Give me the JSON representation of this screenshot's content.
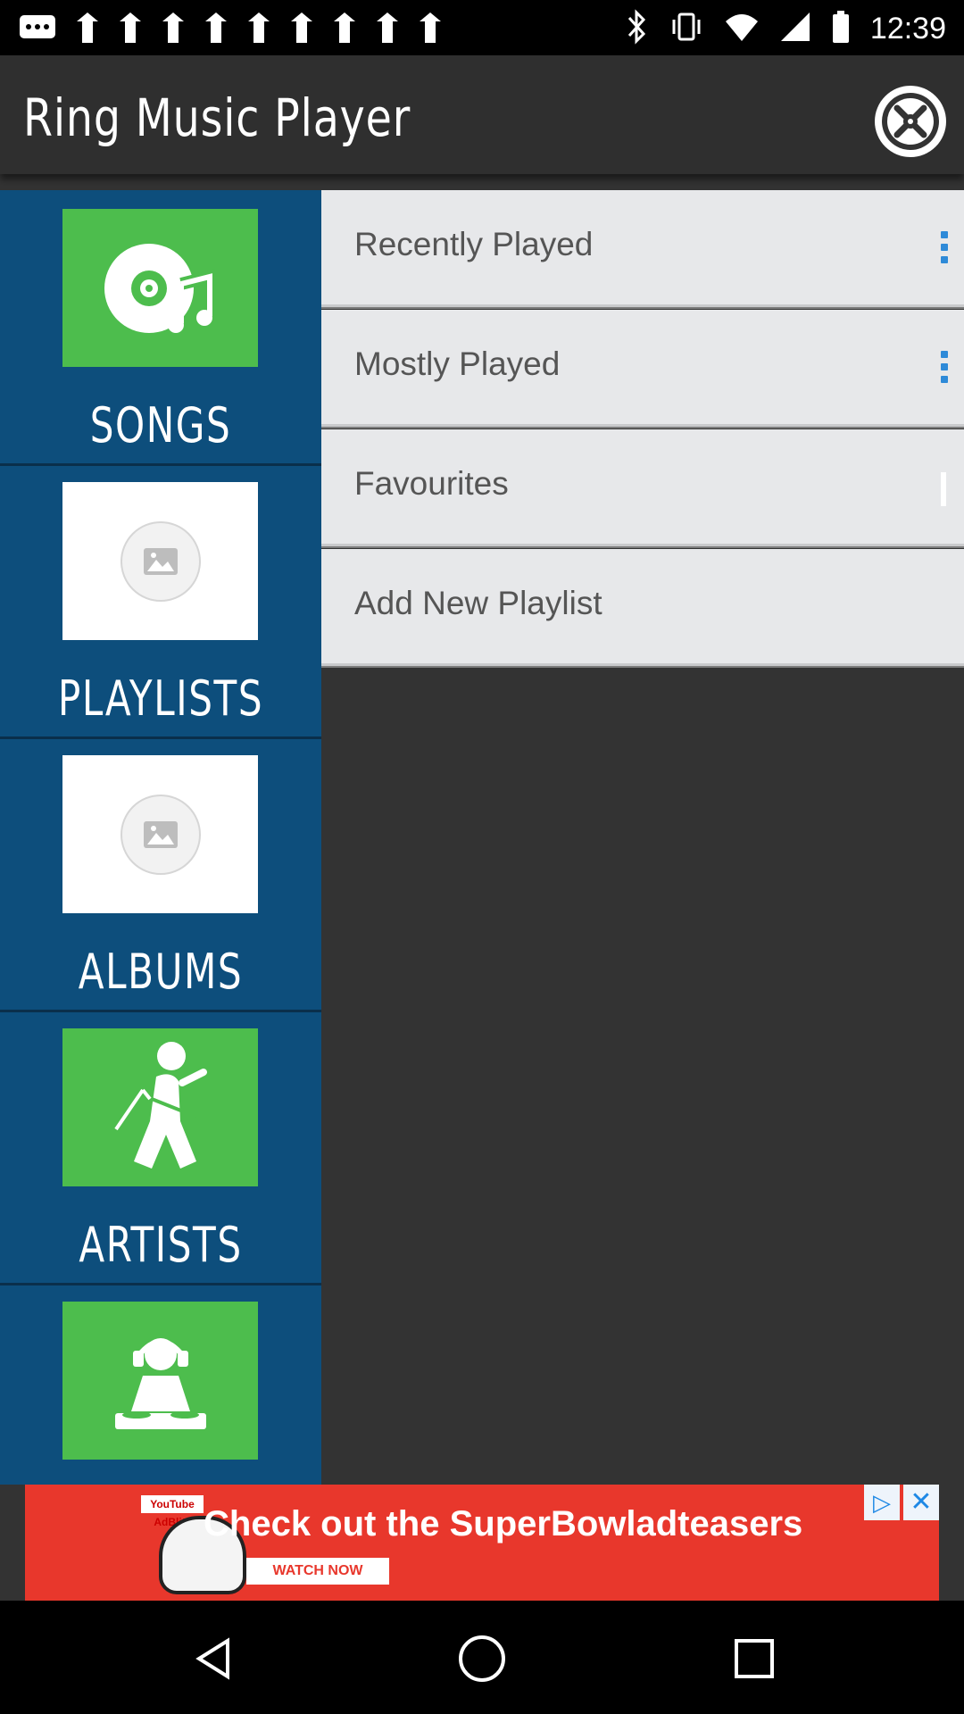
{
  "status_bar": {
    "time": "12:39",
    "icons": [
      "message-icon",
      "notification-icon",
      "notification-icon",
      "notification-icon",
      "notification-icon",
      "notification-icon",
      "notification-icon",
      "notification-icon",
      "notification-icon",
      "notification-icon"
    ]
  },
  "header": {
    "title": "Ring Music Player"
  },
  "sidebar": {
    "categories": [
      {
        "label": "SONGS",
        "icon": "music-disc-icon",
        "tile_color": "#4dbd4d"
      },
      {
        "label": "PLAYLISTS",
        "icon": "image-placeholder-icon",
        "tile_color": "#ffffff"
      },
      {
        "label": "ALBUMS",
        "icon": "image-placeholder-icon",
        "tile_color": "#ffffff"
      },
      {
        "label": "ARTISTS",
        "icon": "singer-icon",
        "tile_color": "#4dbd4d"
      },
      {
        "label": "",
        "icon": "dj-icon",
        "tile_color": "#4dbd4d"
      }
    ]
  },
  "menu": {
    "items": [
      {
        "label": "Recently Played"
      },
      {
        "label": "Mostly Played"
      },
      {
        "label": "Favourites"
      },
      {
        "label": "Add New Playlist"
      }
    ]
  },
  "ad": {
    "text": "Check out the SuperBowladteasers",
    "cta": "WATCH NOW",
    "logo": "YouTube AdBlitz"
  },
  "colors": {
    "accent": "#0d4e7c",
    "tile_green": "#4dbd4d",
    "menu_dots": "#2e8ad8",
    "ad_red": "#e8372c"
  }
}
